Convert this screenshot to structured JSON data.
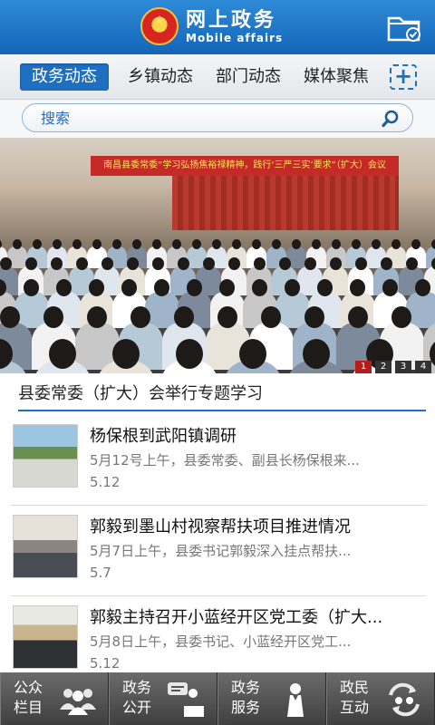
{
  "header": {
    "title": "网上政务",
    "subtitle": "Mobile affairs",
    "emblem_icon": "national-emblem-icon",
    "folder_icon": "folder-check-icon",
    "brand_color": "#1f6fc0"
  },
  "tabs": [
    {
      "label": "政务动态",
      "active": true
    },
    {
      "label": "乡镇动态",
      "active": false
    },
    {
      "label": "部门动态",
      "active": false
    },
    {
      "label": "媒体聚焦",
      "active": false
    }
  ],
  "tab_add_label": "+",
  "search": {
    "placeholder": "搜索",
    "icon": "search-icon"
  },
  "banner": {
    "caption_on_photo": "南昌县委常委“学习弘扬焦裕禄精神，践行‘三严三实’要求”（扩大）会议",
    "pager": [
      "1",
      "2",
      "3",
      "4"
    ],
    "active_page": "1",
    "feature_title": "县委常委（扩大）会举行专题学习"
  },
  "news": [
    {
      "title": "杨保根到武阳镇调研",
      "summary": "5月12号上午，县委常委、副县长杨保根来...",
      "date": "5.12"
    },
    {
      "title": "郭毅到墨山村视察帮扶项目推进情况",
      "summary": "5月7日上午，县委书记郭毅深入挂点帮扶...",
      "date": "5.7"
    },
    {
      "title": "郭毅主持召开小蓝经开区党工委（扩大...",
      "summary": "5月8日上午，县委书记、小蓝经开区党工...",
      "date": "5.12"
    }
  ],
  "bottom_nav": [
    {
      "label": "公众栏目",
      "icon": "people-group-icon"
    },
    {
      "label": "政务公开",
      "icon": "speaker-podium-icon"
    },
    {
      "label": "政务服务",
      "icon": "service-staff-icon"
    },
    {
      "label": "政民互动",
      "icon": "interaction-exchange-icon"
    }
  ]
}
